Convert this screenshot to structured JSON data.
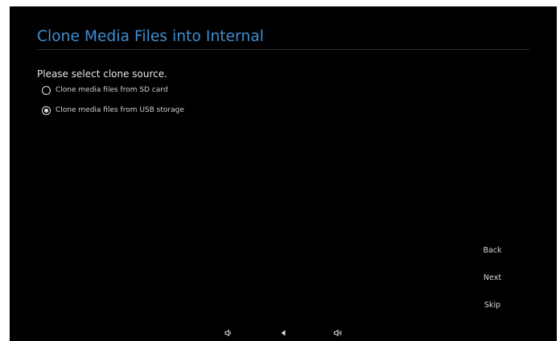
{
  "header": {
    "title": "Clone Media Files into Internal"
  },
  "main": {
    "prompt": "Please select clone source.",
    "options": [
      {
        "label": "Clone media files from SD card",
        "selected": false
      },
      {
        "label": "Clone media files from USB storage",
        "selected": true
      }
    ]
  },
  "buttons": {
    "back": "Back",
    "next": "Next",
    "skip": "Skip"
  },
  "system_bar": {
    "icons": [
      "volume-down-icon",
      "back-nav-icon",
      "volume-up-icon"
    ]
  },
  "colors": {
    "title": "#3d8fd6",
    "background": "#000000",
    "text": "#e6e6e6"
  }
}
